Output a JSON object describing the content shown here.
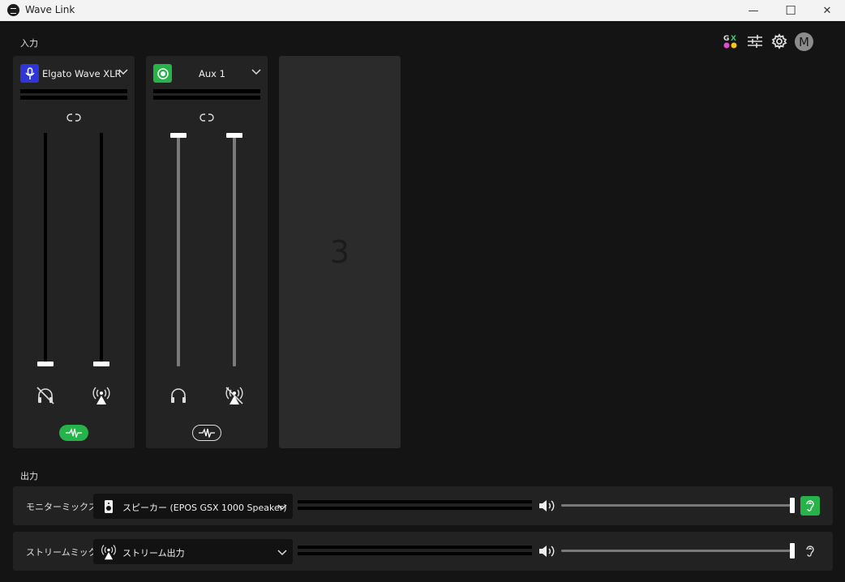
{
  "window": {
    "title": "Wave Link",
    "minimize": "—",
    "maximize": "☐",
    "close": "✕"
  },
  "sections": {
    "input": "入力",
    "output": "出力"
  },
  "top_icons": {
    "mixer_icon": "gx-icon",
    "eq_icon": "sliders-icon",
    "settings_icon": "gear-icon",
    "avatar_letter": "M"
  },
  "channels": [
    {
      "name": "Elgato Wave XLR",
      "badge_color": "#2f35d6",
      "badge_icon": "microphone-icon",
      "fader_monitor": 0.0,
      "fader_stream": 0.0,
      "monitor_muted": true,
      "stream_muted": false,
      "fx_active": true
    },
    {
      "name": "Aux 1",
      "badge_color": "#26b34a",
      "badge_icon": "record-icon",
      "fader_monitor": 1.0,
      "fader_stream": 1.0,
      "monitor_muted": false,
      "stream_muted": true,
      "fx_active": false
    }
  ],
  "add_tile": {
    "label": "3"
  },
  "outputs": [
    {
      "label": "モニターミックス",
      "device": "スピーカー (EPOS GSX 1000 Speaker)",
      "device_icon": "speaker-icon",
      "volume": 1.0,
      "listen_active": true
    },
    {
      "label": "ストリームミックス",
      "device": "ストリーム出力",
      "device_icon": "broadcast-icon",
      "volume": 1.0,
      "listen_active": false
    }
  ],
  "colors": {
    "accent_green": "#26b34a",
    "background": "#141414",
    "panel": "#232323"
  }
}
